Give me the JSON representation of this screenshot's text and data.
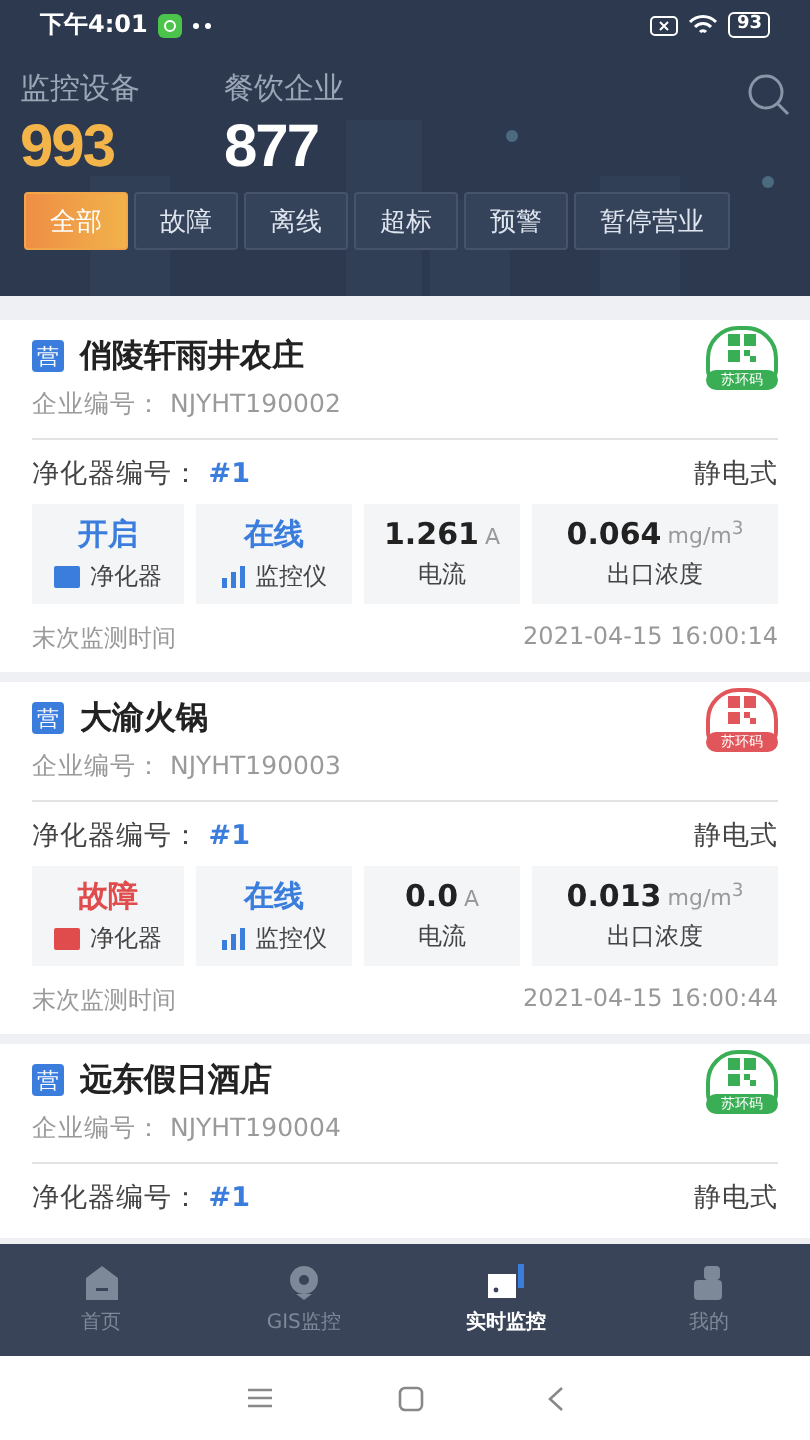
{
  "status_bar": {
    "time": "下午4:01",
    "battery": "93"
  },
  "summary": [
    {
      "label": "监控设备",
      "value": "993",
      "kind": "highlight"
    },
    {
      "label": "餐饮企业",
      "value": "877",
      "kind": "plain"
    }
  ],
  "filters": [
    {
      "label": "全部",
      "selected": true
    },
    {
      "label": "故障",
      "selected": false
    },
    {
      "label": "离线",
      "selected": false
    },
    {
      "label": "超标",
      "selected": false
    },
    {
      "label": "预警",
      "selected": false
    },
    {
      "label": "暂停营业",
      "selected": false
    }
  ],
  "cards": [
    {
      "tag": "营",
      "name": "俏陵轩雨井农庄",
      "code_label": "企业编号：",
      "code": "NJYHT190002",
      "qr": {
        "label": "苏环码",
        "color": "#3aae55"
      },
      "purifier_label": "净化器编号：",
      "purifier_no": "#1",
      "purifier_type": "静电式",
      "purifier_status": {
        "value": "开启",
        "fault": false,
        "label": "净化器"
      },
      "monitor_status": {
        "value": "在线",
        "fault": false,
        "label": "监控仪"
      },
      "current": {
        "value": "1.261",
        "unit": "A",
        "label": "电流"
      },
      "concentration": {
        "value": "0.064",
        "unit": "mg/m$^{3}$",
        "label": "出口浓度"
      },
      "time_label": "末次监测时间",
      "time": "2021-04-15 16:00:14"
    },
    {
      "tag": "营",
      "name": "大渝火锅",
      "code_label": "企业编号：",
      "code": "NJYHT190003",
      "qr": {
        "label": "苏环码",
        "color": "#e0565b"
      },
      "purifier_label": "净化器编号：",
      "purifier_no": "#1",
      "purifier_type": "静电式",
      "purifier_status": {
        "value": "故障",
        "fault": true,
        "label": "净化器"
      },
      "monitor_status": {
        "value": "在线",
        "fault": false,
        "label": "监控仪"
      },
      "current": {
        "value": "0.0",
        "unit": "A",
        "label": "电流"
      },
      "concentration": {
        "value": "0.013",
        "unit": "mg/m$^{3}$",
        "label": "出口浓度"
      },
      "time_label": "末次监测时间",
      "time": "2021-04-15 16:00:44"
    },
    {
      "tag": "营",
      "name": "远东假日酒店",
      "code_label": "企业编号：",
      "code": "NJYHT190004",
      "qr": {
        "label": "苏环码",
        "color": "#3aae55"
      },
      "purifier_label": "净化器编号：",
      "purifier_no": "#1",
      "purifier_type": "静电式"
    }
  ],
  "tab_bar": [
    {
      "label": "首页",
      "selected": false
    },
    {
      "label": "GIS监控",
      "selected": false
    },
    {
      "label": "实时监控",
      "selected": true
    },
    {
      "label": "我的",
      "selected": false
    }
  ]
}
